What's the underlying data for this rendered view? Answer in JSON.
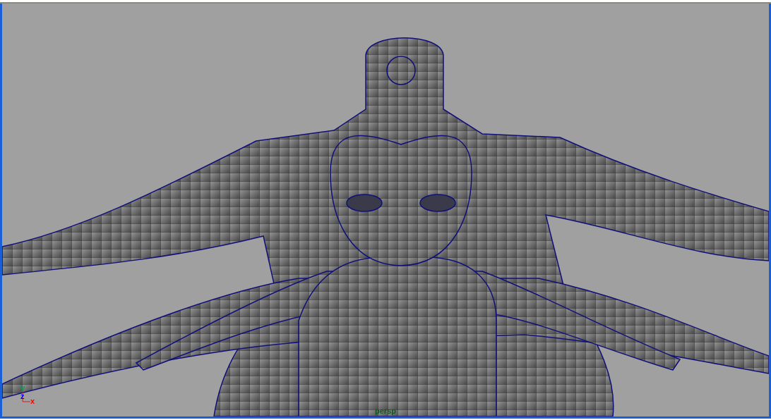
{
  "viewport": {
    "camera_label": "persp",
    "axis_labels": [
      {
        "label": "y",
        "color": "#00a050"
      },
      {
        "label": "z",
        "color": "#0000ff"
      },
      {
        "label": "x",
        "color": "#ff0000"
      }
    ]
  }
}
